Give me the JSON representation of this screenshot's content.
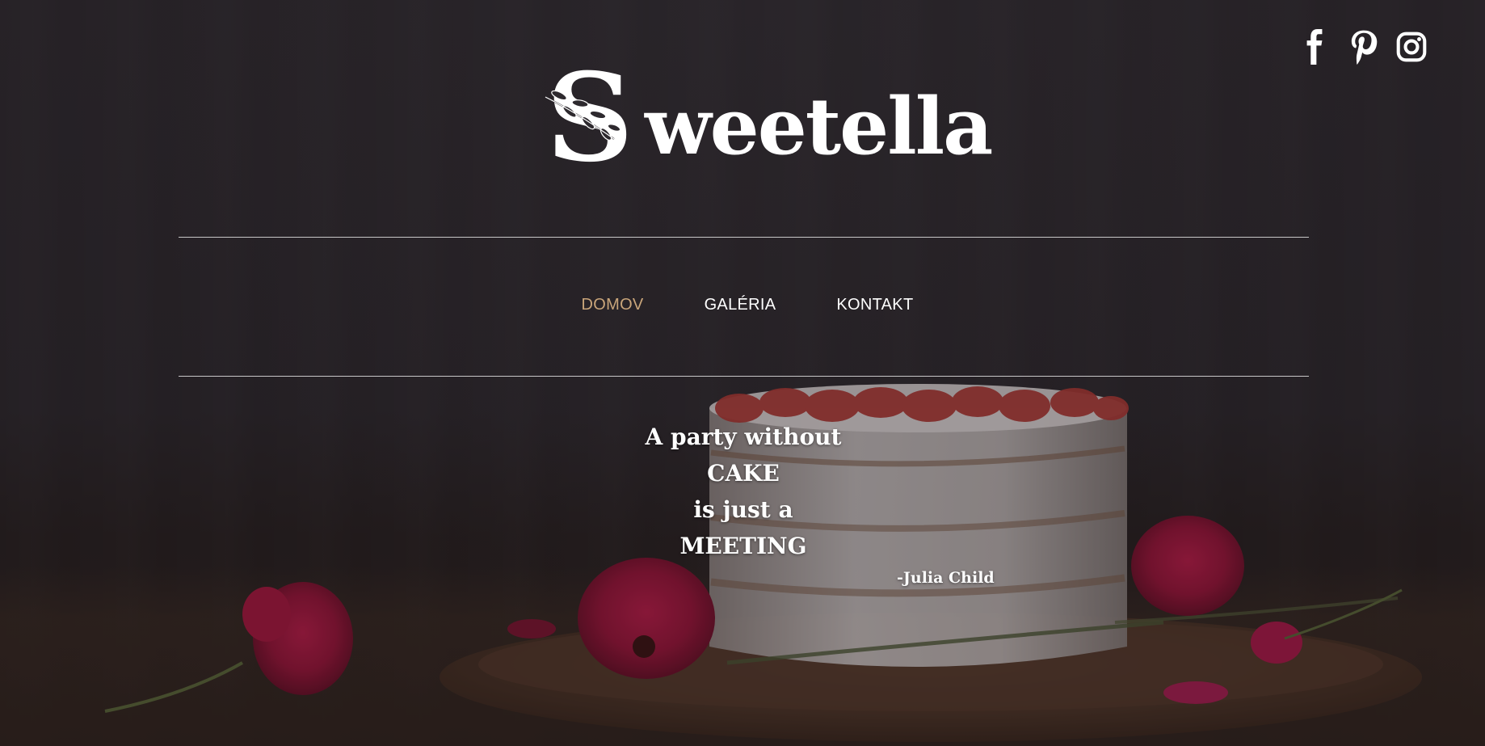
{
  "brand": {
    "name": "Sweetella",
    "initial": "S",
    "rest": "weetella"
  },
  "social": [
    {
      "name": "facebook-icon"
    },
    {
      "name": "pinterest-icon"
    },
    {
      "name": "instagram-icon"
    }
  ],
  "nav": {
    "items": [
      {
        "label": "DOMOV",
        "active": true
      },
      {
        "label": "GALÉRIA",
        "active": false
      },
      {
        "label": "KONTAKT",
        "active": false
      }
    ]
  },
  "quote": {
    "lines": [
      "A party without",
      "CAKE",
      "is just a",
      "MEETING"
    ],
    "author": "-Julia Child"
  },
  "colors": {
    "accent": "#c9a57a",
    "text": "#ffffff",
    "background": "#2b272c"
  }
}
